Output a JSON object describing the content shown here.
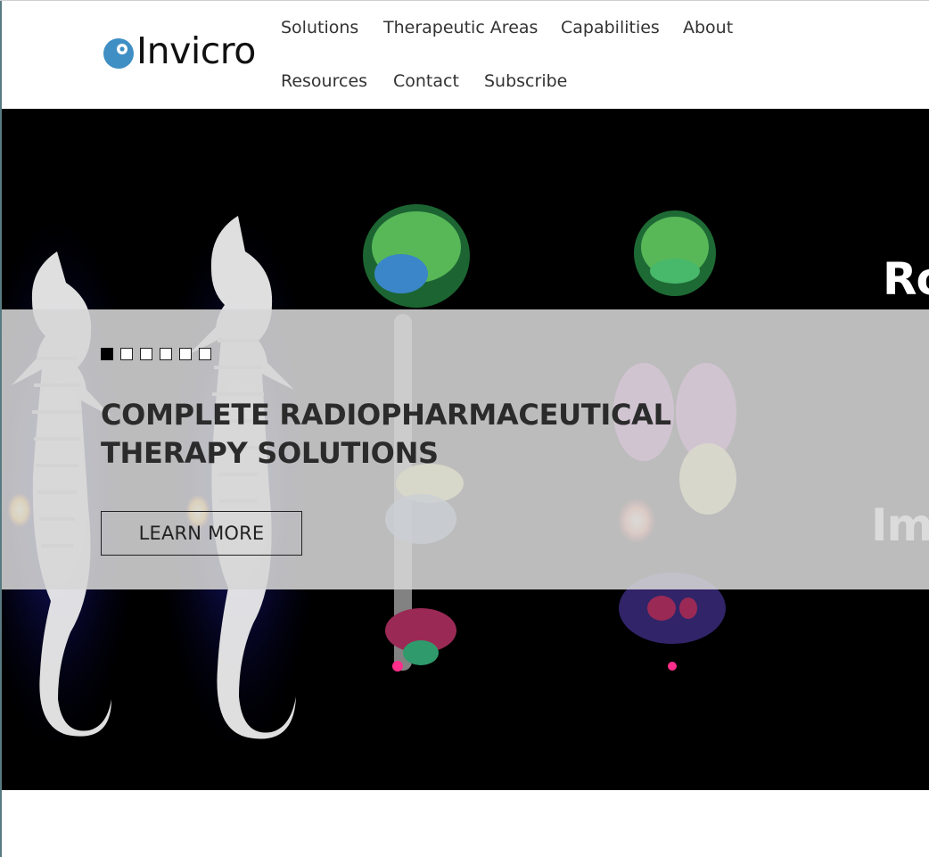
{
  "brand": {
    "name": "Invicro",
    "logo_color": "#3f8fc4"
  },
  "nav": {
    "items": [
      {
        "label": "Solutions"
      },
      {
        "label": "Therapeutic Areas"
      },
      {
        "label": "Capabilities"
      },
      {
        "label": "About"
      },
      {
        "label": "Resources"
      },
      {
        "label": "Contact"
      },
      {
        "label": "Subscribe"
      }
    ]
  },
  "hero": {
    "background_image": "preclinical and clinical SPECT/CT whole-body scans",
    "side_text_top": "Ro",
    "side_text_bottom": "Im",
    "slides": {
      "count": 6,
      "active_index": 0
    },
    "title_line1": "COMPLETE RADIOPHARMACEUTICAL",
    "title_line2": "THERAPY SOLUTIONS",
    "cta_label": "LEARN MORE"
  },
  "colors": {
    "hero_bg": "#000000",
    "overlay": "#d6d6d6",
    "text_dark": "#2b2b2b"
  }
}
